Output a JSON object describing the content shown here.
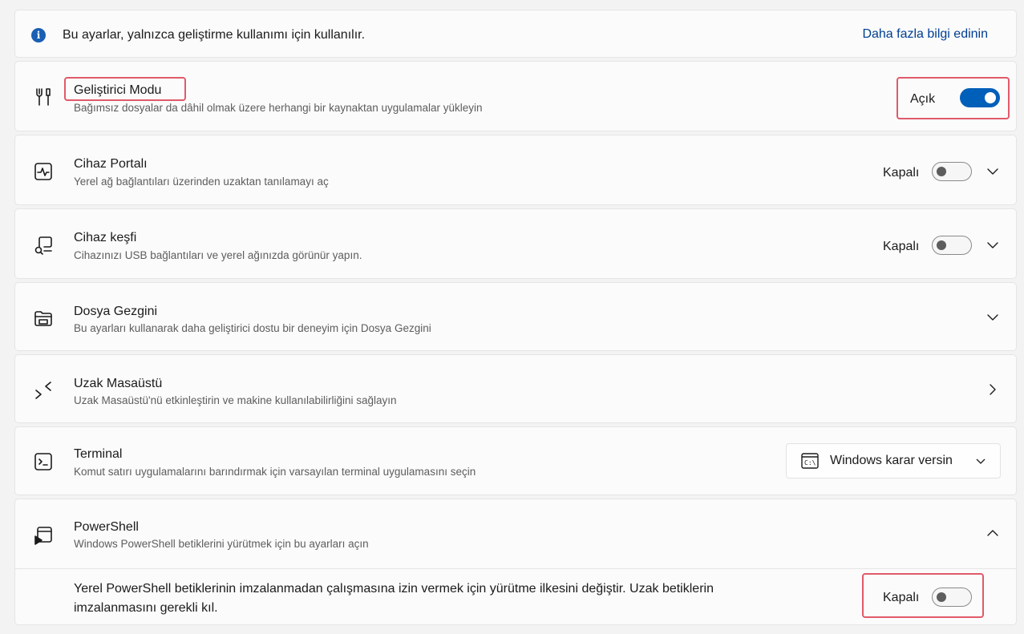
{
  "info": {
    "text": "Bu ayarlar, yalnızca geliştirme kullanımı için kullanılır.",
    "link": "Daha fazla bilgi edinin",
    "icon": "info-icon"
  },
  "developer_mode": {
    "title": "Geliştirici Modu",
    "desc": "Bağımsız dosyalar da dâhil olmak üzere herhangi bir kaynaktan uygulamalar yükleyin",
    "state": "Açık",
    "on": true,
    "icon": "developer-tools-icon"
  },
  "device_portal": {
    "title": "Cihaz Portalı",
    "desc": "Yerel ağ bağlantıları üzerinden uzaktan tanılamayı aç",
    "state": "Kapalı",
    "on": false,
    "icon": "device-portal-icon"
  },
  "device_discovery": {
    "title": "Cihaz keşfi",
    "desc": "Cihazınızı USB bağlantıları ve yerel ağınızda görünür yapın.",
    "state": "Kapalı",
    "on": false,
    "icon": "device-discovery-icon"
  },
  "file_explorer": {
    "title": "Dosya Gezgini",
    "desc": "Bu ayarları kullanarak daha geliştirici dostu bir deneyim için Dosya Gezgini",
    "icon": "folder-icon"
  },
  "remote_desktop": {
    "title": "Uzak Masaüstü",
    "desc": "Uzak Masaüstü'nü etkinleştirin ve makine kullanılabilirliğini sağlayın",
    "icon": "remote-desktop-icon"
  },
  "terminal": {
    "title": "Terminal",
    "desc": "Komut satırı uygulamalarını barındırmak için varsayılan terminal uygulamasını seçin",
    "selected": "Windows karar versin",
    "icon": "terminal-icon"
  },
  "powershell": {
    "title": "PowerShell",
    "desc": "Windows PowerShell betiklerini yürütmek için bu ayarları açın",
    "sub_text": "Yerel PowerShell betiklerinin imzalanmadan çalışmasına izin vermek için yürütme ilkesini değiştir. Uzak betiklerin imzalanmasını gerekli kıl.",
    "sub_state": "Kapalı",
    "sub_on": false,
    "icon": "powershell-icon"
  },
  "colors": {
    "accent": "#005fb8",
    "highlight": "#e05a6a"
  }
}
